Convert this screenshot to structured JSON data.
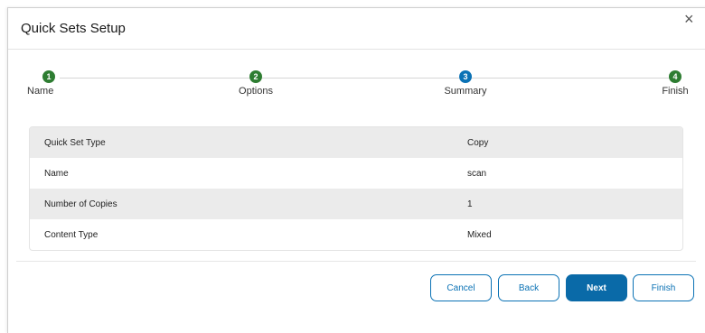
{
  "dialog": {
    "title": "Quick Sets Setup",
    "close_glyph": "×"
  },
  "stepper": {
    "steps": [
      {
        "number": "1",
        "label": "Name",
        "state": "completed",
        "color": "#2e7d32"
      },
      {
        "number": "2",
        "label": "Options",
        "state": "completed",
        "color": "#2e7d32"
      },
      {
        "number": "3",
        "label": "Summary",
        "state": "current",
        "color": "#0b72b5"
      },
      {
        "number": "4",
        "label": "Finish",
        "state": "completed",
        "color": "#2e7d32"
      }
    ]
  },
  "summary": {
    "rows": [
      {
        "key": "Quick Set Type",
        "value": "Copy"
      },
      {
        "key": "Name",
        "value": "scan"
      },
      {
        "key": "Number of Copies",
        "value": "1"
      },
      {
        "key": "Content Type",
        "value": "Mixed"
      }
    ]
  },
  "buttons": {
    "cancel": "Cancel",
    "back": "Back",
    "next": "Next",
    "finish": "Finish"
  },
  "colors": {
    "accent": "#0b72b5",
    "success": "#2e7d32",
    "row_shade": "#ebebeb"
  }
}
